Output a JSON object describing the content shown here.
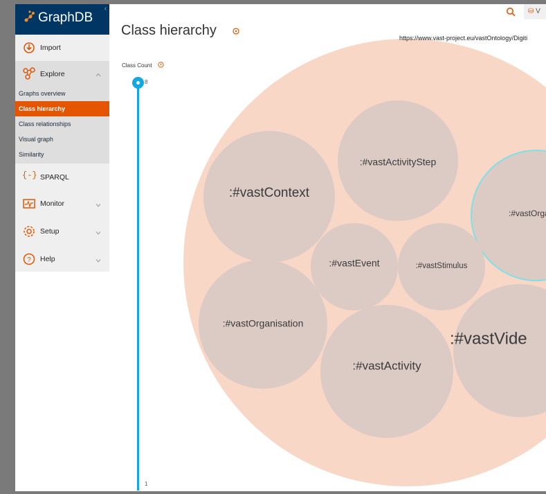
{
  "app": {
    "name": "GraphDB"
  },
  "sidebar": {
    "items": [
      {
        "label": "Import",
        "icon": "import-icon"
      },
      {
        "label": "Explore",
        "icon": "explore-icon"
      },
      {
        "label": "SPARQL",
        "icon": "sparql-icon"
      },
      {
        "label": "Monitor",
        "icon": "monitor-icon"
      },
      {
        "label": "Setup",
        "icon": "setup-icon"
      },
      {
        "label": "Help",
        "icon": "help-icon"
      }
    ],
    "explore_subitems": [
      {
        "label": "Graphs overview",
        "active": false
      },
      {
        "label": "Class hierarchy",
        "active": true
      },
      {
        "label": "Class relationships",
        "active": false
      },
      {
        "label": "Visual graph",
        "active": false
      },
      {
        "label": "Similarity",
        "active": false
      }
    ]
  },
  "header": {
    "lang_button": "V"
  },
  "page": {
    "title": "Class hierarchy",
    "graph_uri": "https://www.vast-project.eu/vastOntology/Digiti"
  },
  "slider": {
    "label": "Class Count",
    "max": "8",
    "min": "1"
  },
  "bubbles": [
    {
      "label": ":#vastContext"
    },
    {
      "label": ":#vastActivityStep"
    },
    {
      "label": ":#vastOrganis"
    },
    {
      "label": ":#vastEvent"
    },
    {
      "label": ":#vastStimulus"
    },
    {
      "label": ":#vastOrganisation"
    },
    {
      "label": ":#vastActivity"
    },
    {
      "label": ":#vastVide"
    }
  ],
  "colors": {
    "sidebar_header": "#003663",
    "active_item": "#e35500",
    "outer_bubble": "#f8d7c6",
    "inner_bubble": "#dccbc5",
    "slider": "#14a7e1",
    "highlight_stroke": "#7fe0e6"
  }
}
